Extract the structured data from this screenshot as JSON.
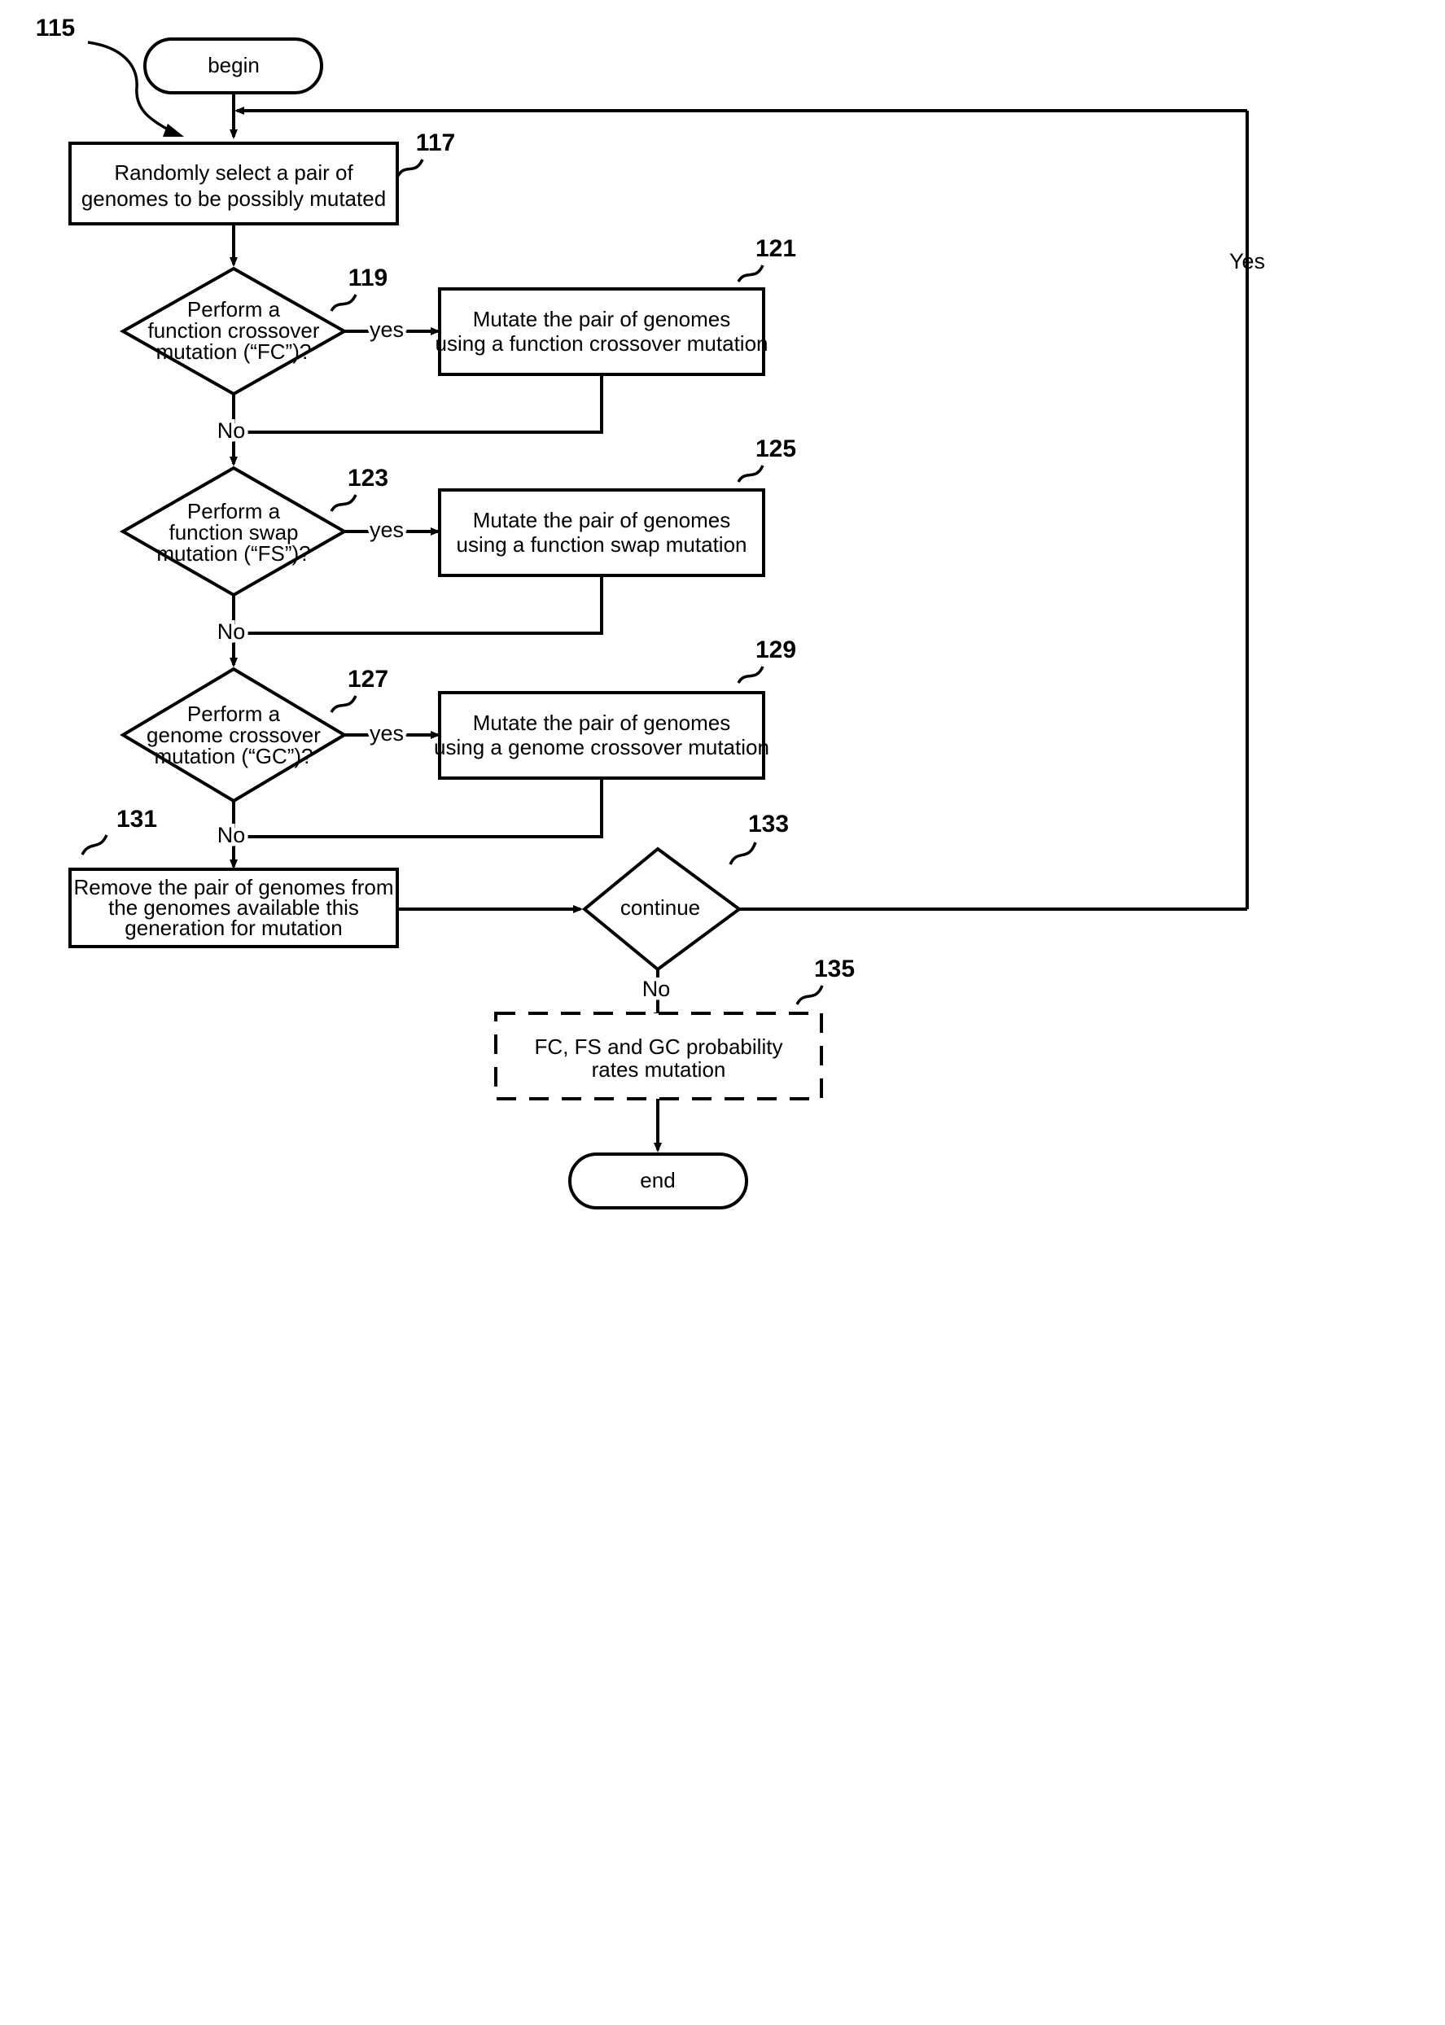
{
  "figure": {
    "figure_ref": "115",
    "terminators": {
      "begin": "begin",
      "end": "end"
    },
    "nodes": [
      {
        "ref": "117",
        "type": "process",
        "lines": [
          "Randomly select a pair of",
          "genomes to be possibly mutated"
        ]
      },
      {
        "ref": "119",
        "type": "decision",
        "lines": [
          "Perform a",
          "function crossover",
          "mutation (“FC”)?"
        ]
      },
      {
        "ref": "121",
        "type": "process",
        "lines": [
          "Mutate the pair of genomes",
          "using a function crossover mutation"
        ]
      },
      {
        "ref": "123",
        "type": "decision",
        "lines": [
          "Perform a",
          "function swap",
          "mutation (“FS”)?"
        ]
      },
      {
        "ref": "125",
        "type": "process",
        "lines": [
          "Mutate the pair of genomes",
          "using a function swap mutation"
        ]
      },
      {
        "ref": "127",
        "type": "decision",
        "lines": [
          "Perform a",
          "genome crossover",
          "mutation (“GC”)?"
        ]
      },
      {
        "ref": "129",
        "type": "process",
        "lines": [
          "Mutate the pair of genomes",
          "using a genome crossover mutation"
        ]
      },
      {
        "ref": "131",
        "type": "process",
        "lines": [
          "Remove the pair of genomes from",
          "the genomes available this",
          "generation for mutation"
        ]
      },
      {
        "ref": "133",
        "type": "decision",
        "lines": [
          "continue"
        ]
      },
      {
        "ref": "135",
        "type": "optional-process",
        "lines": [
          "FC, FS and GC probability",
          "rates mutation"
        ]
      }
    ],
    "edge_labels": {
      "yes_fc": "yes",
      "no_fc": "No",
      "yes_fs": "yes",
      "no_fs": "No",
      "yes_gc": "yes",
      "no_gc": "No",
      "continue_yes": "Yes",
      "continue_no": "No"
    }
  }
}
